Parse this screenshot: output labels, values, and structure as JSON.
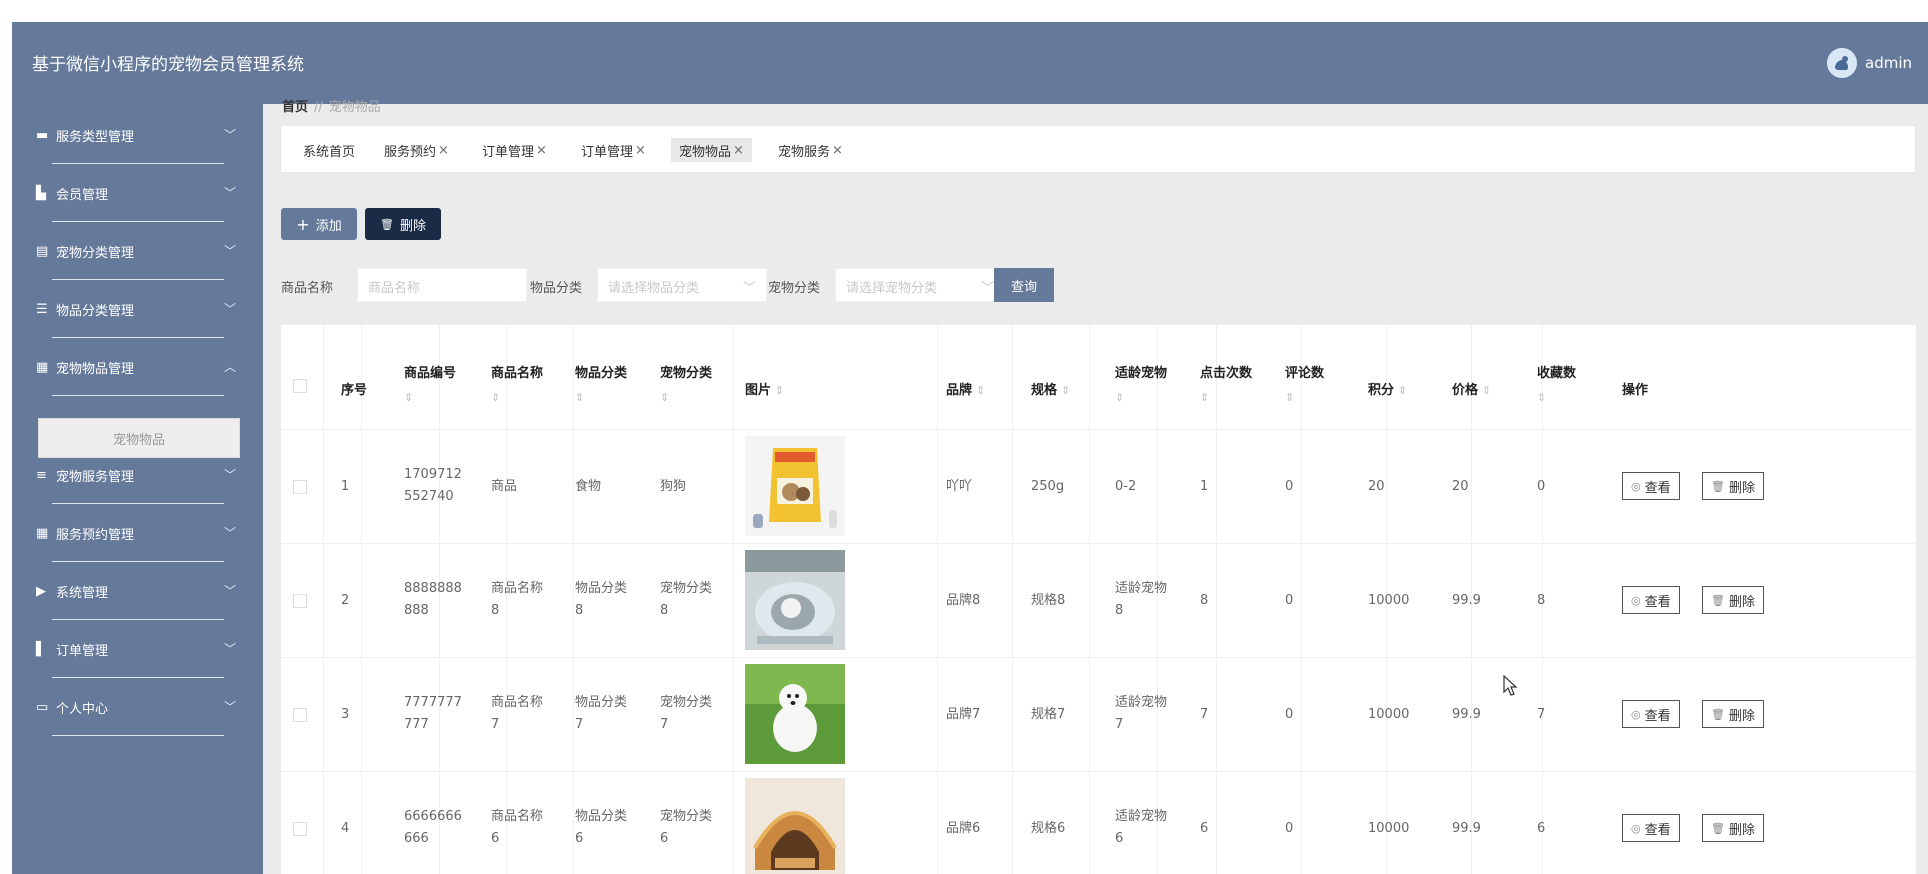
{
  "app": {
    "title": "基于微信小程序的宠物会员管理系统",
    "user": "admin"
  },
  "sidebar": {
    "items": [
      {
        "label": "服务类型管理",
        "icon": "briefcase-icon",
        "glyph": "▬",
        "expanded": false
      },
      {
        "label": "会员管理",
        "icon": "thumb-up-icon",
        "glyph": "▙",
        "expanded": false
      },
      {
        "label": "宠物分类管理",
        "icon": "clipboard-icon",
        "glyph": "▤",
        "expanded": false
      },
      {
        "label": "物品分类管理",
        "icon": "sliders-icon",
        "glyph": "☰",
        "expanded": false
      },
      {
        "label": "宠物物品管理",
        "icon": "grid-icon",
        "glyph": "▦",
        "expanded": true
      },
      {
        "label": "宠物服务管理",
        "icon": "list-icon",
        "glyph": "≡",
        "expanded": false
      },
      {
        "label": "服务预约管理",
        "icon": "grid-icon",
        "glyph": "▦",
        "expanded": false
      },
      {
        "label": "系统管理",
        "icon": "flag-icon",
        "glyph": "▶",
        "expanded": false
      },
      {
        "label": "订单管理",
        "icon": "chart-icon",
        "glyph": "▌",
        "expanded": false
      },
      {
        "label": "个人中心",
        "icon": "calendar-icon",
        "glyph": "▭",
        "expanded": false
      }
    ],
    "sub_item": "宠物物品"
  },
  "breadcrumb": {
    "home": "首页",
    "sep": "//",
    "current": "宠物物品"
  },
  "tabs": [
    {
      "label": "系统首页",
      "closable": false
    },
    {
      "label": "服务预约",
      "closable": true
    },
    {
      "label": "订单管理",
      "closable": true
    },
    {
      "label": "订单管理",
      "closable": true
    },
    {
      "label": "宠物物品",
      "closable": true,
      "active": true
    },
    {
      "label": "宠物服务",
      "closable": true
    }
  ],
  "tab_close": "×",
  "toolbar": {
    "add_label": "添加",
    "add_glyph": "+",
    "delete_label": "删除",
    "delete_glyph": "🗑"
  },
  "search": {
    "name_label": "商品名称",
    "name_placeholder": "商品名称",
    "item_category_label": "物品分类",
    "item_category_placeholder": "请选择物品分类",
    "pet_category_label": "宠物分类",
    "pet_category_placeholder": "请选择宠物分类",
    "query_label": "查询"
  },
  "table": {
    "headers": {
      "index": "序号",
      "code": "商品编号",
      "name": "商品名称",
      "item_cat": "物品分类",
      "pet_cat": "宠物分类",
      "image": "图片",
      "brand": "品牌",
      "spec": "规格",
      "age": "适龄宠物",
      "clicks": "点击次数",
      "comments": "评论数",
      "points": "积分",
      "price": "价格",
      "favorites": "收藏数",
      "ops": "操作"
    },
    "sort_glyph": "⇕",
    "view_label": "查看",
    "delete_label": "删除",
    "rows": [
      {
        "index": "1",
        "code": [
          "1709712",
          "552740"
        ],
        "name": [
          "商品"
        ],
        "item_cat": [
          "食物"
        ],
        "pet_cat": [
          "狗狗"
        ],
        "image": "dog-food-bag",
        "brand": "吖吖",
        "spec": "250g",
        "age": [
          "0-2"
        ],
        "clicks": "1",
        "comments": "0",
        "points": "20",
        "price": "20",
        "favorites": "0"
      },
      {
        "index": "2",
        "code": [
          "8888888",
          "888"
        ],
        "name": [
          "商品名称",
          "8"
        ],
        "item_cat": [
          "物品分类",
          "8"
        ],
        "pet_cat": [
          "宠物分类",
          "8"
        ],
        "image": "pet-litter-box",
        "brand": "品牌8",
        "spec": "规格8",
        "age": [
          "适龄宠物",
          "8"
        ],
        "clicks": "8",
        "comments": "0",
        "points": "10000",
        "price": "99.9",
        "favorites": "8"
      },
      {
        "index": "3",
        "code": [
          "7777777",
          "777"
        ],
        "name": [
          "商品名称",
          "7"
        ],
        "item_cat": [
          "物品分类",
          "7"
        ],
        "pet_cat": [
          "宠物分类",
          "7"
        ],
        "image": "white-dog-on-grass",
        "brand": "品牌7",
        "spec": "规格7",
        "age": [
          "适龄宠物",
          "7"
        ],
        "clicks": "7",
        "comments": "0",
        "points": "10000",
        "price": "99.9",
        "favorites": "7"
      },
      {
        "index": "4",
        "code": [
          "6666666",
          "666"
        ],
        "name": [
          "商品名称",
          "6"
        ],
        "item_cat": [
          "物品分类",
          "6"
        ],
        "pet_cat": [
          "宠物分类",
          "6"
        ],
        "image": "pet-house",
        "brand": "品牌6",
        "spec": "规格6",
        "age": [
          "适龄宠物",
          "6"
        ],
        "clicks": "6",
        "comments": "0",
        "points": "10000",
        "price": "99.9",
        "favorites": "6"
      }
    ]
  },
  "colors": {
    "primary": "#65799b",
    "dark": "#1b2a45",
    "page_bg": "#ebebeb"
  }
}
